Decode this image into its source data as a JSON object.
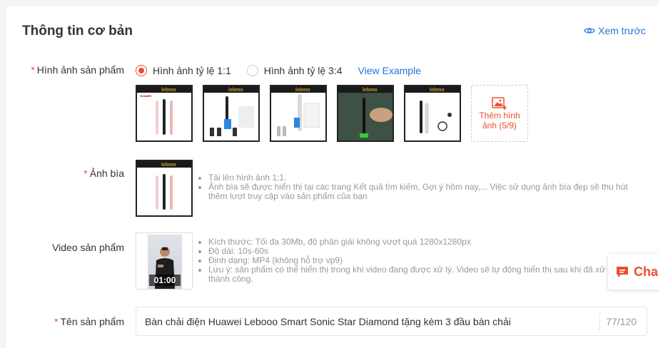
{
  "section": {
    "title": "Thông tin cơ bản",
    "preview_label": "Xem trước"
  },
  "images": {
    "label": "Hình ảnh sản phẩm",
    "ratio_options": [
      "Hình ảnh tỷ lệ 1:1",
      "Hình ảnh tỷ lệ 3:4"
    ],
    "selected_ratio": "Hình ảnh tỷ lệ 1:1",
    "view_example": "View Example",
    "thumb_brand": "lebmo",
    "thumb_logo_text": "HUAWEI",
    "add_label_line1": "Thêm hình",
    "add_label_line2": "ảnh (5/9)"
  },
  "cover": {
    "label": "Ảnh bìa",
    "hints": [
      "Tải lên hình ảnh 1:1.",
      "Ảnh bìa sẽ được hiển thị tại các trang Kết quả tìm kiếm, Gợi ý hôm nay,... Việc sử dụng ảnh bìa đẹp sẽ thu hút thêm lượt truy cập vào sản phẩm của bạn"
    ]
  },
  "video": {
    "label": "Video sản phẩm",
    "duration": "01:00",
    "hints": [
      "Kích thước: Tối đa 30Mb, độ phân giải không vượt quá 1280x1280px",
      "Độ dài: 10s-60s",
      "Định dạng: MP4 (không hỗ trợ vp9)",
      "Lưu ý: sản phẩm có thể hiển thị trong khi video đang được xử lý. Video sẽ tự động hiển thị sau khi đã xử lý thành công."
    ]
  },
  "product_name": {
    "label": "Tên sản phẩm",
    "value": "Bàn chải điện Huawei Lebooo Smart Sonic Star Diamond tặng kèm 3 đầu bàn chải",
    "counter": "77/120"
  },
  "chat": {
    "label": "Chat"
  },
  "colors": {
    "accent": "#ee4d2d",
    "link": "#2673dd"
  }
}
